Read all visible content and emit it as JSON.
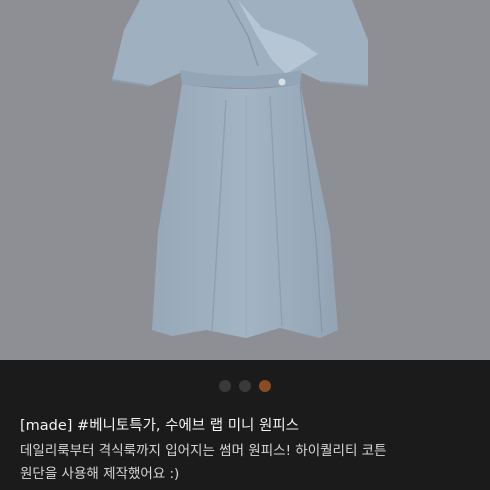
{
  "product": {
    "image_alt": "blue wrap mini dress",
    "title": "[made] #베니토특가, 수에브 랩 미니 원피스",
    "description_lines": [
      "데일리룩부터 격식룩까지 입어지는 썸머 원피스! 하이퀄리티 코튼",
      "원단을 사용해 제작했어요 :)"
    ]
  },
  "carousel": {
    "total": 3,
    "active_index": 2
  },
  "colors": {
    "photo_background": "#8d8f94",
    "dress": "#9fb1c1",
    "panel_background": "#1b1b1b",
    "dot_inactive": "#3a3a3a",
    "dot_active": "#8a4c22"
  }
}
